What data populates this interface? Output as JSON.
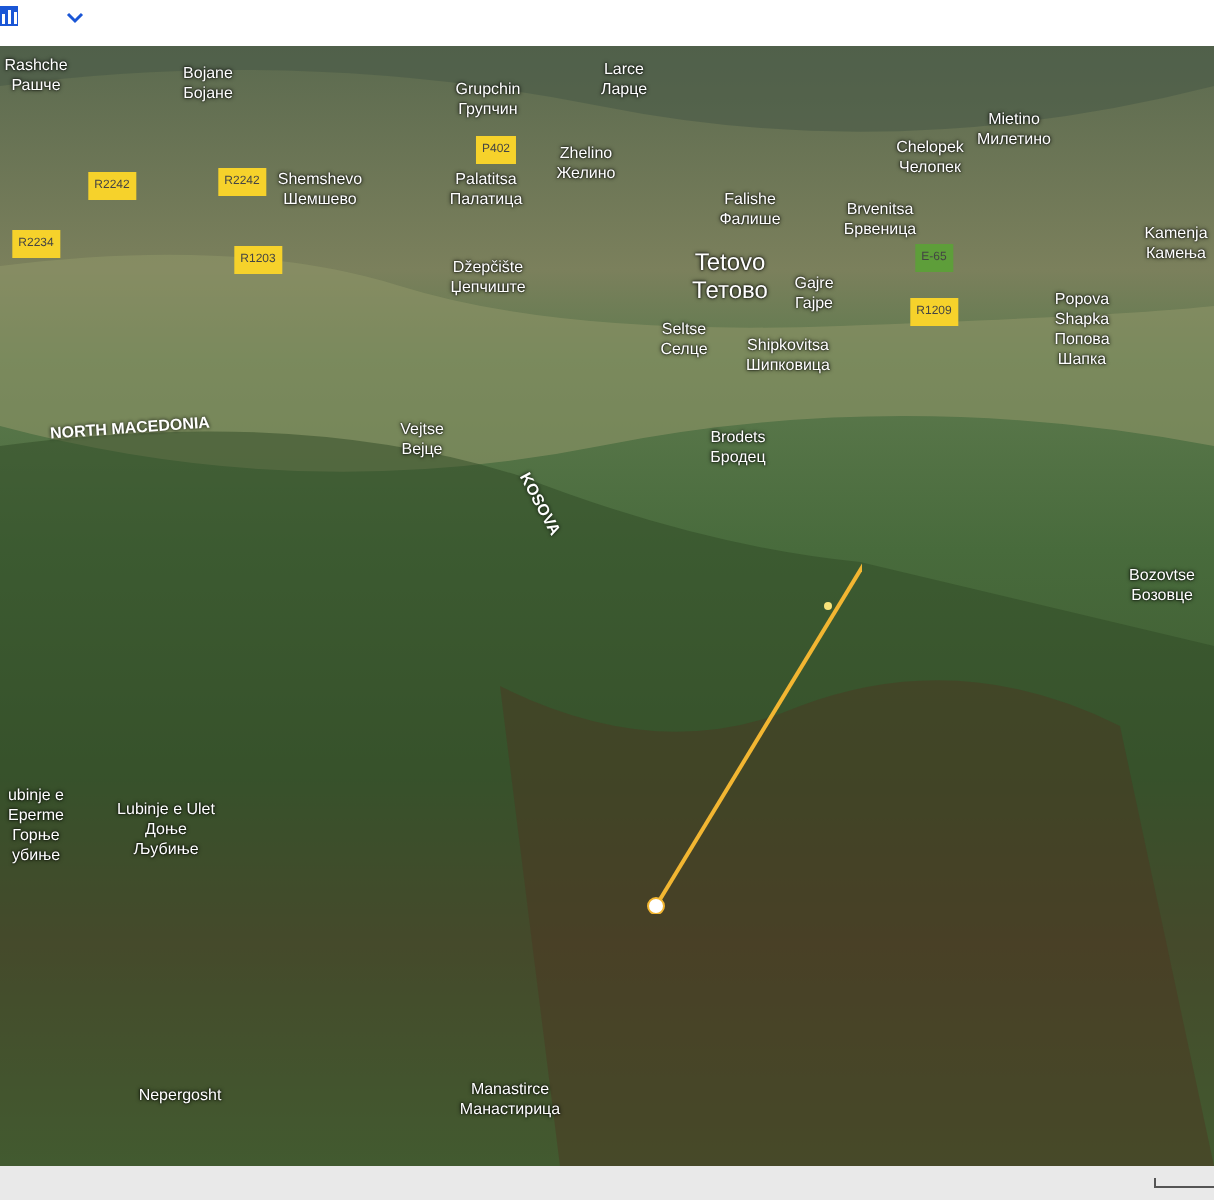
{
  "map": {
    "labels": [
      {
        "kind": "place",
        "lines": [
          "Rashche",
          "Рашче"
        ]
      },
      {
        "kind": "place",
        "lines": [
          "Bojane",
          "Бојане"
        ]
      },
      {
        "kind": "place",
        "lines": [
          "Grupchin",
          "Групчин"
        ]
      },
      {
        "kind": "place",
        "lines": [
          "Larce",
          "Ларце"
        ]
      },
      {
        "kind": "shield",
        "text": "P402",
        "color": "#f6d22b"
      },
      {
        "kind": "place",
        "lines": [
          "Zhelino",
          "Желино"
        ]
      },
      {
        "kind": "shield",
        "text": "R2242",
        "color": "#f6d22b"
      },
      {
        "kind": "shield",
        "text": "R2242",
        "color": "#f6d22b"
      },
      {
        "kind": "place",
        "lines": [
          "Shemshevo",
          "Шемшево"
        ]
      },
      {
        "kind": "place",
        "lines": [
          "Palatitsa",
          "Палатица"
        ]
      },
      {
        "kind": "shield",
        "text": "R2234",
        "color": "#f6d22b"
      },
      {
        "kind": "shield",
        "text": "R1203",
        "color": "#f6d22b"
      },
      {
        "kind": "place",
        "lines": [
          "Džepčište",
          "Џепчиште"
        ]
      },
      {
        "kind": "place",
        "lines": [
          "Chelopek",
          "Челопек"
        ]
      },
      {
        "kind": "place",
        "lines": [
          "Mietino",
          "Милетино"
        ]
      },
      {
        "kind": "place",
        "lines": [
          "Falishe",
          "Фалише"
        ]
      },
      {
        "kind": "place",
        "lines": [
          "Brvenitsa",
          "Брвеница"
        ]
      },
      {
        "kind": "place",
        "lines": [
          "Kamenja",
          "Камења"
        ]
      },
      {
        "kind": "city",
        "lines": [
          "Tetovo",
          "Тетово"
        ]
      },
      {
        "kind": "place",
        "lines": [
          "Gajre",
          "Гајре"
        ]
      },
      {
        "kind": "shield",
        "text": "E-65",
        "color": "#5e9e3a"
      },
      {
        "kind": "place",
        "lines": [
          "Seltse",
          "Селце"
        ]
      },
      {
        "kind": "place",
        "lines": [
          "Shipkovitsa",
          "Шипковица"
        ]
      },
      {
        "kind": "shield",
        "text": "R1209",
        "color": "#f6d22b"
      },
      {
        "kind": "place",
        "lines": [
          "Popova",
          "Shapka",
          "Попова",
          "Шапка"
        ]
      },
      {
        "kind": "country",
        "text": "NORTH MACEDONIA"
      },
      {
        "kind": "place",
        "lines": [
          "Vejtse",
          "Вејце"
        ]
      },
      {
        "kind": "country",
        "text": "KOSOVA"
      },
      {
        "kind": "place",
        "lines": [
          "Brodets",
          "Бродец"
        ]
      },
      {
        "kind": "place",
        "lines": [
          "Bozovtse",
          "Бозовце"
        ]
      },
      {
        "kind": "place",
        "lines": [
          "ubinje e",
          "Eperme",
          "Горње",
          "убиње"
        ]
      },
      {
        "kind": "place",
        "lines": [
          "Lubinje e Ulet",
          "Доње",
          "Љубиње"
        ]
      },
      {
        "kind": "place",
        "lines": [
          "Nepergosht"
        ]
      },
      {
        "kind": "place",
        "lines": [
          "Manastirce",
          "Манастирица"
        ]
      }
    ]
  }
}
